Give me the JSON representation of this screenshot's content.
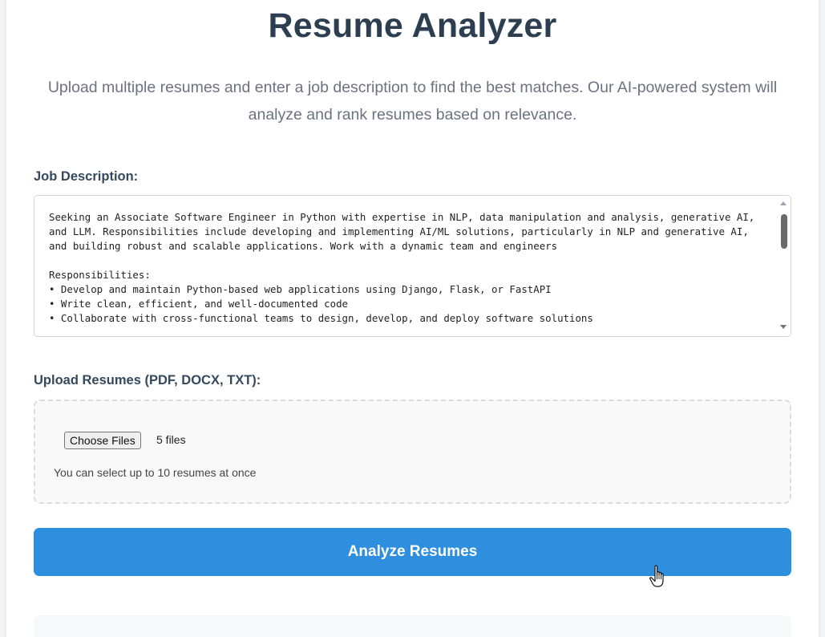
{
  "header": {
    "title": "Resume Analyzer",
    "subtitle": "Upload multiple resumes and enter a job description to find the best matches. Our AI-powered system will analyze and rank resumes based on relevance."
  },
  "job_description": {
    "label": "Job Description:",
    "value": "Seeking an Associate Software Engineer in Python with expertise in NLP, data manipulation and analysis, generative AI, and LLM. Responsibilities include developing and implementing AI/ML solutions, particularly in NLP and generative AI, and building robust and scalable applications. Work with a dynamic team and engineers\n\nResponsibilities:\n• Develop and maintain Python-based web applications using Django, Flask, or FastAPI\n• Write clean, efficient, and well-documented code\n• Collaborate with cross-functional teams to design, develop, and deploy software solutions"
  },
  "upload": {
    "label": "Upload Resumes (PDF, DOCX, TXT):",
    "choose_button": "Choose Files",
    "file_status": "5 files",
    "hint": "You can select up to 10 resumes at once"
  },
  "actions": {
    "analyze_label": "Analyze Resumes"
  },
  "colors": {
    "accent": "#2e8fdf",
    "title": "#2c3e50"
  },
  "icons": {
    "cursor": "hand-pointer-icon",
    "scroll_up": "chevron-up-icon",
    "scroll_down": "chevron-down-icon"
  }
}
